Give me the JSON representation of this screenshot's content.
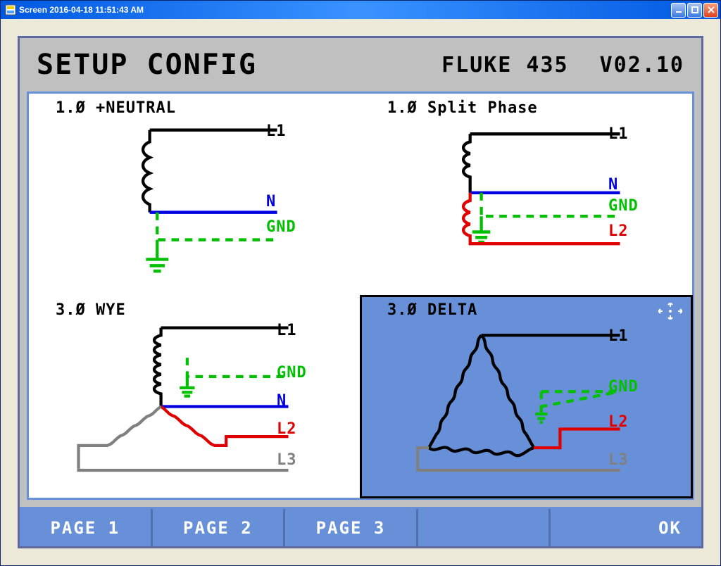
{
  "window": {
    "title": "Screen  2016-04-18  11:51:43 AM"
  },
  "header": {
    "title": "SETUP CONFIG",
    "device": "FLUKE 435",
    "version": "V02.10"
  },
  "configs": [
    {
      "title": "1.Ø +NEUTRAL",
      "lines": [
        "L1",
        "N",
        "GND"
      ],
      "selected": false
    },
    {
      "title": "1.Ø Split Phase",
      "lines": [
        "L1",
        "N",
        "GND",
        "L2"
      ],
      "selected": false
    },
    {
      "title": "3.Ø WYE",
      "lines": [
        "L1",
        "GND",
        "N",
        "L2",
        "L3"
      ],
      "selected": false
    },
    {
      "title": "3.Ø DELTA",
      "lines": [
        "L1",
        "GND",
        "L2",
        "L3"
      ],
      "selected": true
    }
  ],
  "footer": {
    "page1": "PAGE 1",
    "page2": "PAGE 2",
    "page3": "PAGE 3",
    "ok": "OK"
  },
  "colors": {
    "L1": "#000000",
    "L2": "#e00000",
    "L3": "#808080",
    "N": "#0000e0",
    "GND": "#00c000"
  }
}
